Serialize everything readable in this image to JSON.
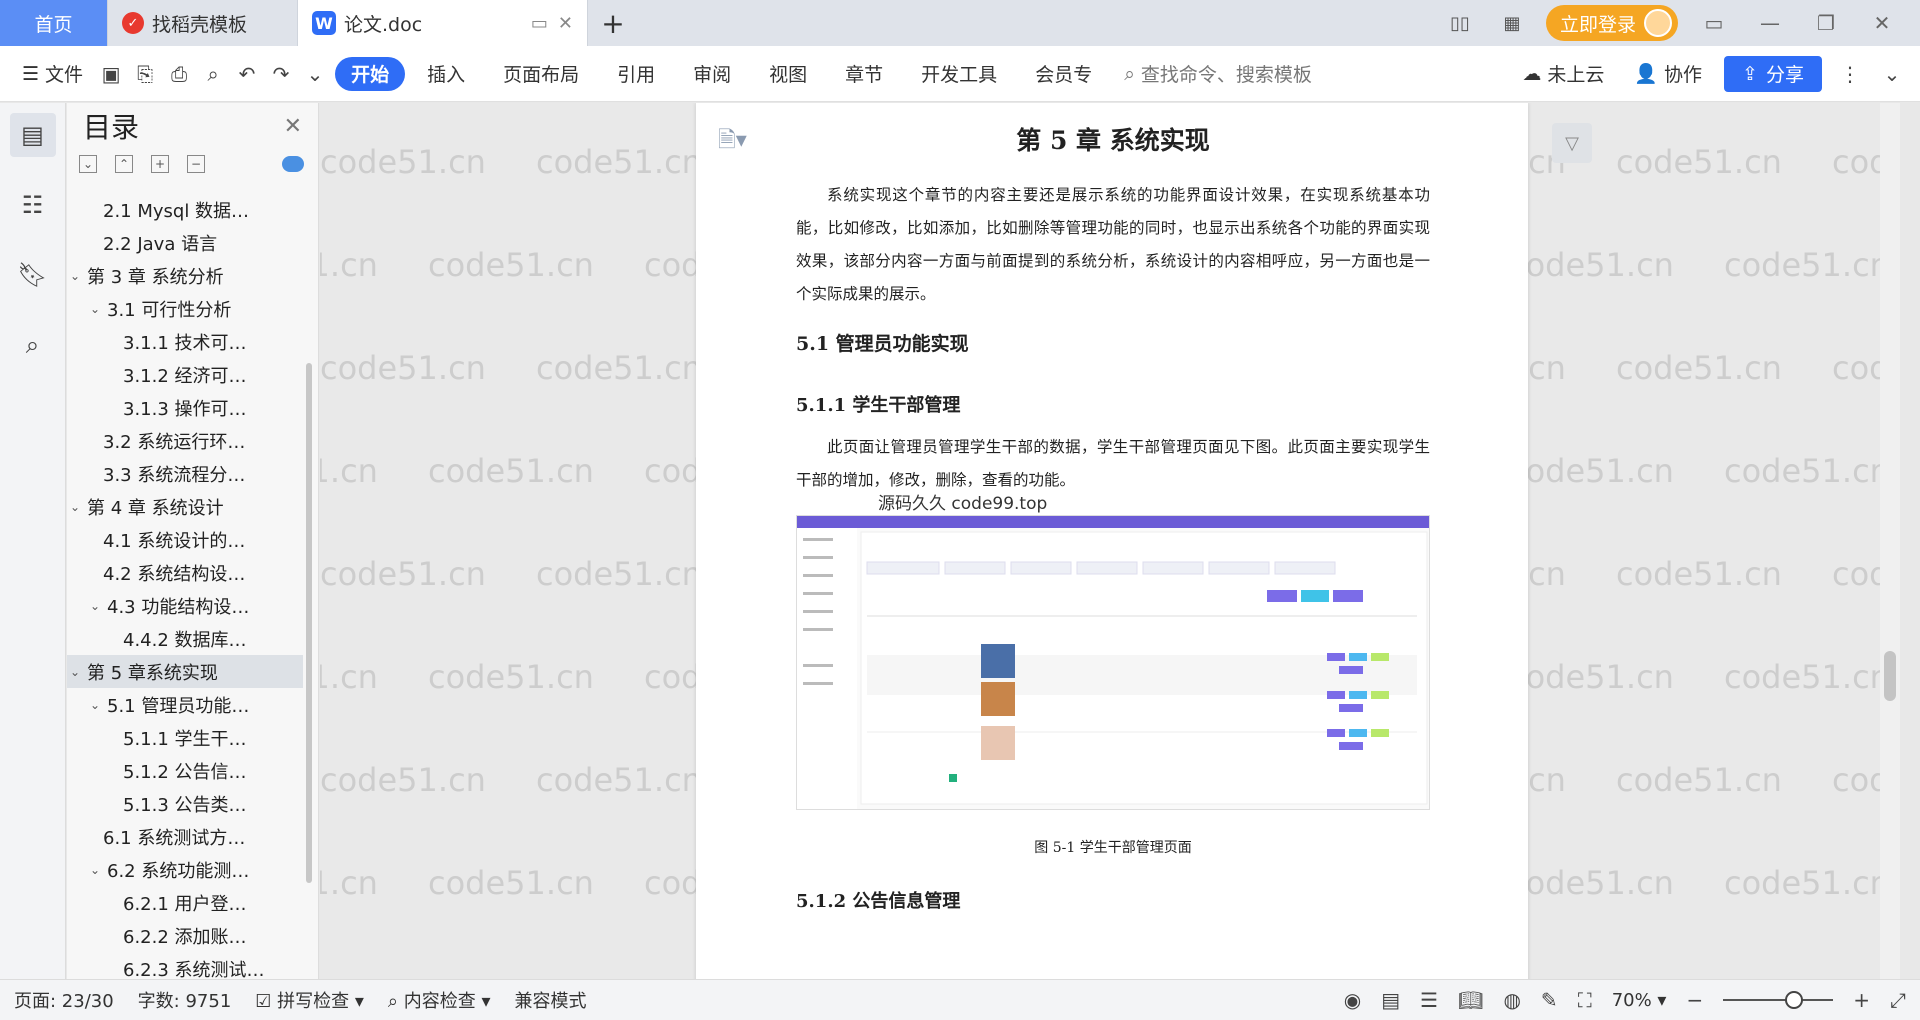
{
  "tabs": {
    "home": "首页",
    "template": "找稻壳模板",
    "doc": "论文.doc"
  },
  "tabbar": {
    "login": "立即登录"
  },
  "toolbar": {
    "file": "文件",
    "ribbon": [
      "开始",
      "插入",
      "页面布局",
      "引用",
      "审阅",
      "视图",
      "章节",
      "开发工具",
      "会员专"
    ],
    "search": "查找命令、搜索模板",
    "cloud": "未上云",
    "collab": "协作",
    "share": "分享"
  },
  "toc": {
    "title": "目录",
    "items": [
      {
        "label": "2.1 Mysql 数据…",
        "level": 2,
        "arrow": ""
      },
      {
        "label": "2.2 Java 语言",
        "level": 2,
        "arrow": ""
      },
      {
        "label": "第 3 章  系统分析",
        "level": 1,
        "arrow": "v"
      },
      {
        "label": "3.1 可行性分析",
        "level": 2,
        "arrow": "v"
      },
      {
        "label": "3.1.1  技术可…",
        "level": 3,
        "arrow": ""
      },
      {
        "label": "3.1.2  经济可…",
        "level": 3,
        "arrow": ""
      },
      {
        "label": "3.1.3  操作可…",
        "level": 3,
        "arrow": ""
      },
      {
        "label": "3.2 系统运行环…",
        "level": 2,
        "arrow": ""
      },
      {
        "label": "3.3 系统流程分…",
        "level": 2,
        "arrow": ""
      },
      {
        "label": "第 4 章  系统设计",
        "level": 1,
        "arrow": "v"
      },
      {
        "label": "4.1  系统设计的…",
        "level": 2,
        "arrow": ""
      },
      {
        "label": "4.2  系统结构设…",
        "level": 2,
        "arrow": ""
      },
      {
        "label": "4.3 功能结构设…",
        "level": 2,
        "arrow": "v"
      },
      {
        "label": "4.4.2  数据库…",
        "level": 3,
        "arrow": ""
      },
      {
        "label": "第 5 章系统实现",
        "level": 1,
        "arrow": "v",
        "selected": true
      },
      {
        "label": "5.1 管理员功能…",
        "level": 2,
        "arrow": "v"
      },
      {
        "label": "5.1.1  学生干…",
        "level": 3,
        "arrow": ""
      },
      {
        "label": "5.1.2  公告信…",
        "level": 3,
        "arrow": ""
      },
      {
        "label": "5.1.3  公告类…",
        "level": 3,
        "arrow": ""
      },
      {
        "label": "6.1 系统测试方…",
        "level": 2,
        "arrow": ""
      },
      {
        "label": "6.2  系统功能测…",
        "level": 2,
        "arrow": "v"
      },
      {
        "label": "6.2.1  用户登…",
        "level": 3,
        "arrow": ""
      },
      {
        "label": "6.2.2  添加账…",
        "level": 3,
        "arrow": ""
      },
      {
        "label": "6.2.3  系统测试…",
        "level": 3,
        "arrow": ""
      }
    ]
  },
  "document": {
    "chapter_title": "第 5 章  系统实现",
    "intro": "系统实现这个章节的内容主要还是展示系统的功能界面设计效果，在实现系统基本功能，比如修改，比如添加，比如删除等管理功能的同时，也显示出系统各个功能的界面实现效果，该部分内容一方面与前面提到的系统分析，系统设计的内容相呼应，另一方面也是一个实际成果的展示。",
    "h2_1": "5.1 管理员功能实现",
    "h3_1": "5.1.1  学生干部管理",
    "para_1": "此页面让管理员管理学生干部的数据，学生干部管理页面见下图。此页面主要实现学生干部的增加，修改，删除，查看的功能。",
    "figure_overlay": "源码久久 code99.top",
    "figure_caption": "图 5-1  学生干部管理页面",
    "h3_2": "5.1.2  公告信息管理",
    "watermark": "code51.cn"
  },
  "status": {
    "page": "页面: 23/30",
    "words": "字数: 9751",
    "spell": "拼写检查",
    "content_check": "内容检查",
    "compat": "兼容模式",
    "zoom": "70%"
  },
  "colors": {
    "accent": "#2f6df6",
    "home_tab": "#5b8ef5",
    "login": "#f5a623"
  }
}
